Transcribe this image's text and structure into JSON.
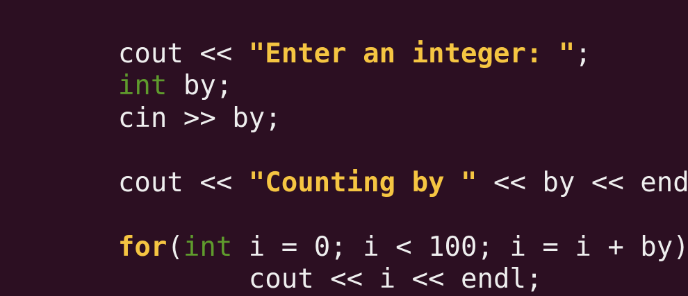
{
  "theme": {
    "background": "#2c0f22",
    "text": "#eeeeee",
    "string": "#f5c542",
    "keyword": "#f5c542",
    "type": "#5f9b2d"
  },
  "code": {
    "lines": [
      [
        {
          "t": "plain",
          "v": "cout << "
        },
        {
          "t": "string",
          "v": "\"Enter an integer: \""
        },
        {
          "t": "plain",
          "v": ";"
        }
      ],
      [
        {
          "t": "type",
          "v": "int"
        },
        {
          "t": "plain",
          "v": " by;"
        }
      ],
      [
        {
          "t": "plain",
          "v": "cin >> by;"
        }
      ],
      [],
      [
        {
          "t": "plain",
          "v": "cout << "
        },
        {
          "t": "string",
          "v": "\"Counting by \""
        },
        {
          "t": "plain",
          "v": " << by << endl;"
        }
      ],
      [],
      [
        {
          "t": "keyword",
          "v": "for"
        },
        {
          "t": "plain",
          "v": "("
        },
        {
          "t": "type",
          "v": "int"
        },
        {
          "t": "plain",
          "v": " i = 0; i < 100; i = i + by)"
        }
      ],
      [
        {
          "t": "plain",
          "v": "        cout << i << endl;"
        }
      ]
    ]
  }
}
